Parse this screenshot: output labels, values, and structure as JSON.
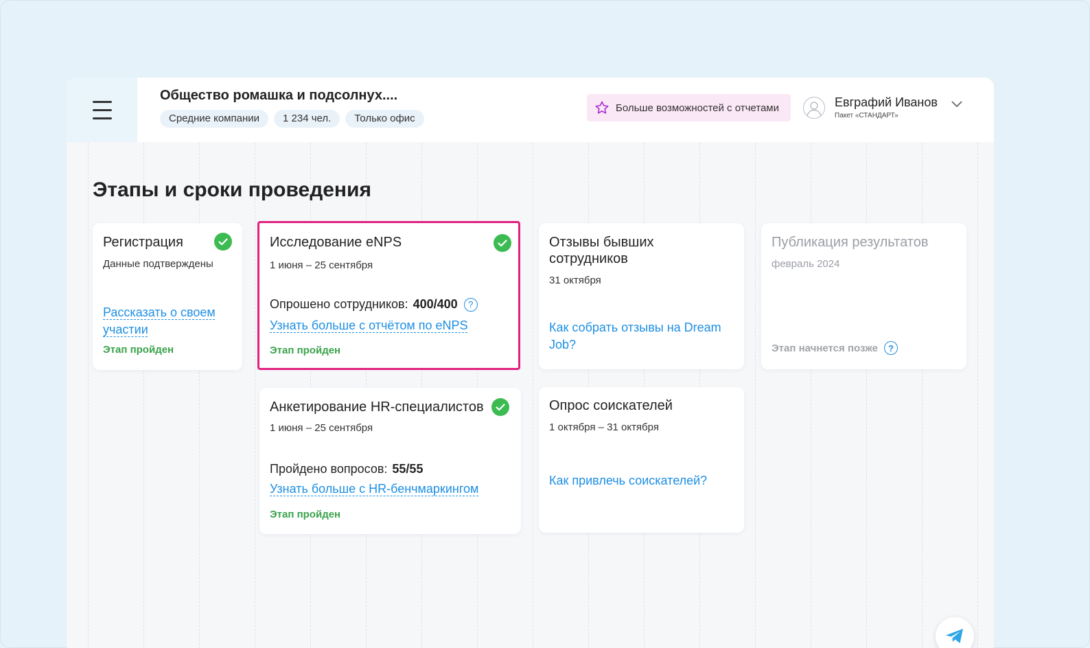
{
  "header": {
    "company_title": "Общество ромашка и подсолнух....",
    "tags": [
      "Средние компании",
      "1 234 чел.",
      "Только офис"
    ],
    "upgrade_label": "Больше возможностей с отчетами",
    "user_name": "Евграфий Иванов",
    "user_plan": "Пакет «СТАНДАРТ»"
  },
  "page_title": "Этапы и сроки проведения",
  "stages": {
    "registration": {
      "title": "Регистрация",
      "subtitle": "Данные подтверждены",
      "link": "Рассказать о своем участии",
      "status": "Этап пройден"
    },
    "enps": {
      "title": "Исследование eNPS",
      "date": "1 июня – 25 сентября",
      "stat_label": "Опрошено сотрудников:",
      "stat_value": "400/400",
      "link": "Узнать больше с отчётом по eNPS",
      "status": "Этап пройден"
    },
    "former": {
      "title": "Отзывы бывших сотрудников",
      "date": "31 октября",
      "link": "Как собрать отзывы на Dream Job?"
    },
    "publication": {
      "title": "Публикация результатов",
      "date": "февраль 2024",
      "status": "Этап начнется позже"
    },
    "hr": {
      "title": "Анкетирование HR-специалистов",
      "date": "1 июня – 25 сентября",
      "stat_label": "Пройдено вопросов:",
      "stat_value": "55/55",
      "link": "Узнать больше с HR-бенчмаркингом",
      "status": "Этап пройден"
    },
    "candidates": {
      "title": "Опрос соискателей",
      "date": "1 октября – 31 октября",
      "link": "Как привлечь соискателей?"
    }
  },
  "colors": {
    "accent": "#1e8fe3",
    "success": "#3dbb53",
    "highlight": "#e0207f",
    "upgrade_bg": "#fbe8f6"
  }
}
